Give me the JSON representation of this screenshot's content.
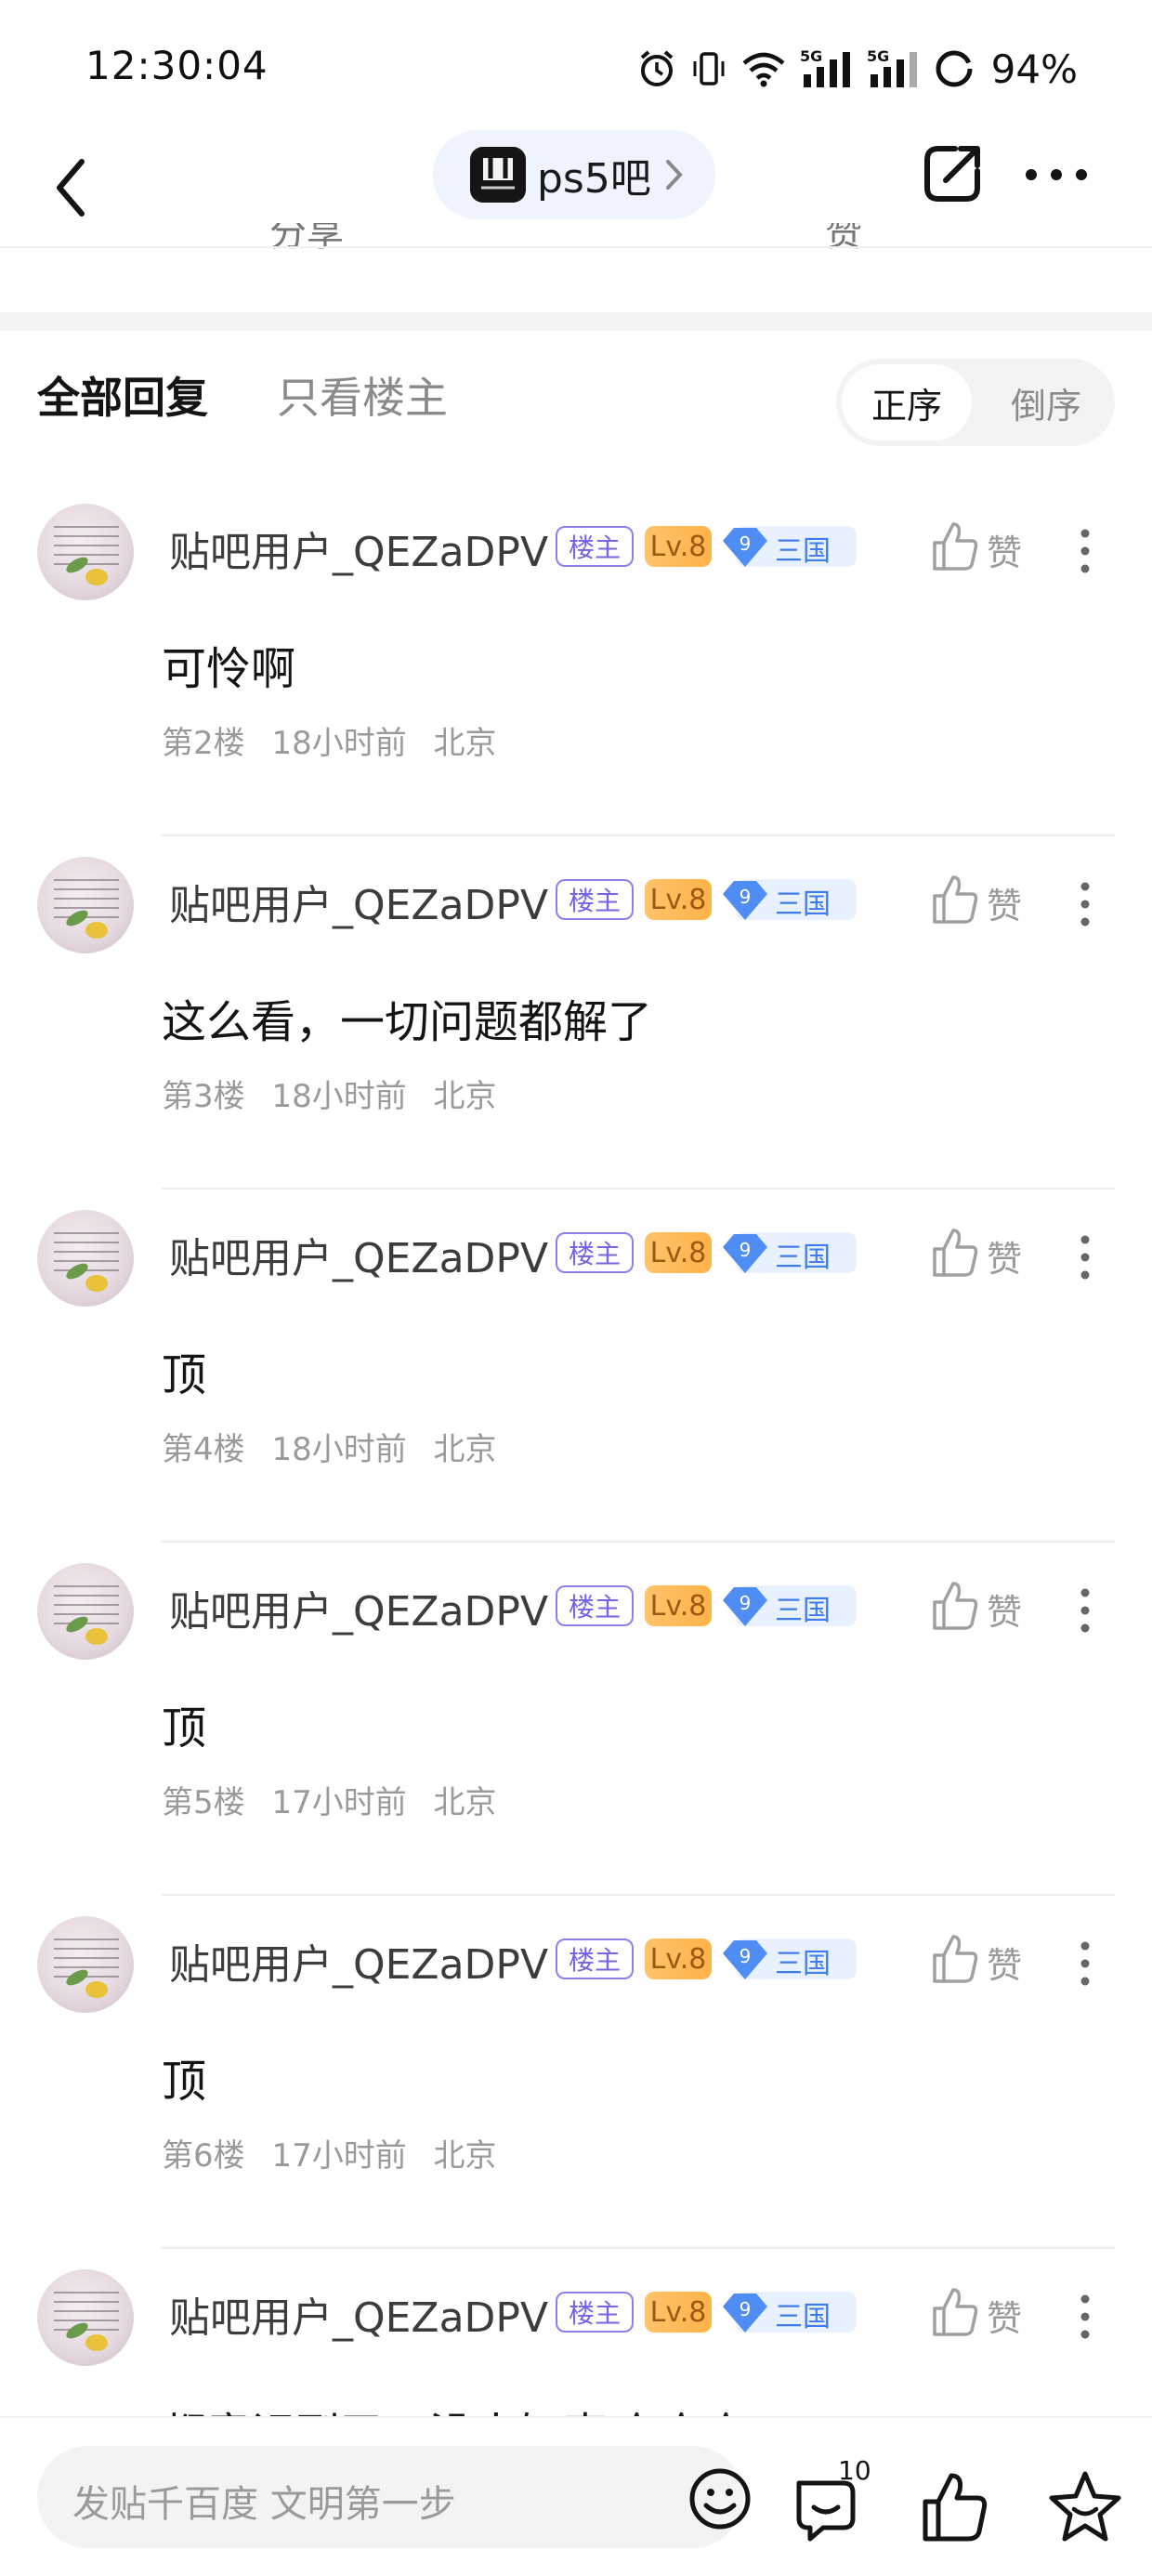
{
  "status_bar": {
    "time": "12:30:04",
    "battery": "94%",
    "network_1": "5G",
    "network_2": "5G"
  },
  "nav": {
    "forum_name": "ps5吧"
  },
  "cut_row": {
    "left": "分享",
    "right": "赞"
  },
  "reply_tabs": {
    "all": "全部回复",
    "owner_only": "只看楼主",
    "sort_asc": "正序",
    "sort_desc": "倒序"
  },
  "replies": [
    {
      "username": "贴吧用户_QEZaDPV",
      "owner_badge": "楼主",
      "level": "Lv.8",
      "vip_level": "9",
      "vip_text": "三国",
      "like_label": "赞",
      "content": "可怜啊",
      "floor": "第2楼",
      "time": "18小时前",
      "location": "北京"
    },
    {
      "username": "贴吧用户_QEZaDPV",
      "owner_badge": "楼主",
      "level": "Lv.8",
      "vip_level": "9",
      "vip_text": "三国",
      "like_label": "赞",
      "content": "这么看，一切问题都解了",
      "floor": "第3楼",
      "time": "18小时前",
      "location": "北京"
    },
    {
      "username": "贴吧用户_QEZaDPV",
      "owner_badge": "楼主",
      "level": "Lv.8",
      "vip_level": "9",
      "vip_text": "三国",
      "like_label": "赞",
      "content": "顶",
      "floor": "第4楼",
      "time": "18小时前",
      "location": "北京"
    },
    {
      "username": "贴吧用户_QEZaDPV",
      "owner_badge": "楼主",
      "level": "Lv.8",
      "vip_level": "9",
      "vip_text": "三国",
      "like_label": "赞",
      "content": "顶",
      "floor": "第5楼",
      "time": "17小时前",
      "location": "北京"
    },
    {
      "username": "贴吧用户_QEZaDPV",
      "owner_badge": "楼主",
      "level": "Lv.8",
      "vip_level": "9",
      "vip_text": "三国",
      "like_label": "赞",
      "content": "顶",
      "floor": "第6楼",
      "time": "17小时前",
      "location": "北京"
    },
    {
      "username": "贴吧用户_QEZaDPV",
      "owner_badge": "楼主",
      "level": "Lv.8",
      "vip_level": "9",
      "vip_text": "三国",
      "like_label": "赞",
      "content": "都意识到了，没人知声哈哈哈",
      "floor": "",
      "time": "",
      "location": ""
    }
  ],
  "bottom_bar": {
    "input_placeholder": "发贴千百度 文明第一步",
    "comment_count": "10"
  },
  "colors": {
    "owner_badge": "#7563e8",
    "level_badge": "#ffb24a",
    "vip_blue": "#3e7df1",
    "chip_bg": "#eef3fd"
  },
  "icons": [
    "alarm-icon",
    "vibrate-icon",
    "wifi-icon",
    "signal-icon",
    "battery-icon",
    "back-icon",
    "chevron-right-icon",
    "share-icon",
    "more-icon",
    "like-icon",
    "more-vert-icon",
    "emoji-icon",
    "comment-icon",
    "thumb-up-icon",
    "favorite-icon"
  ]
}
